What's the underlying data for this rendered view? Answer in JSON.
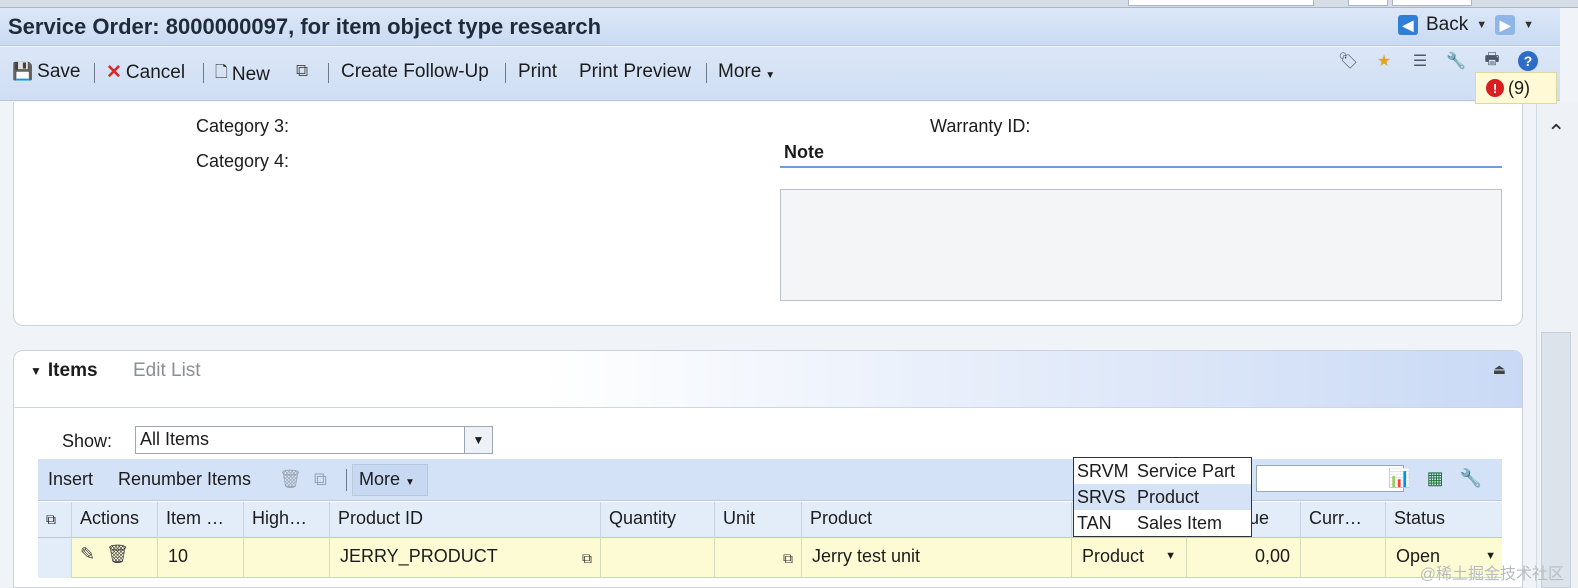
{
  "window": {
    "title": "Service Order: 8000000097, for item object type research",
    "back_label": "Back"
  },
  "toolbar": {
    "save": "Save",
    "cancel": "Cancel",
    "new": "New",
    "create_follow_up": "Create Follow-Up",
    "print": "Print",
    "print_preview": "Print Preview",
    "more": "More"
  },
  "messages": {
    "count": "(9)"
  },
  "details": {
    "category3": "Category 3:",
    "category4": "Category 4:",
    "warranty_id": "Warranty ID:",
    "note_title": "Note"
  },
  "items": {
    "title": "Items",
    "edit_list": "Edit List",
    "show_label": "Show:",
    "show_value": "All Items",
    "list_toolbar": {
      "insert": "Insert",
      "renumber": "Renumber Items",
      "more": "More"
    },
    "columns": [
      "Actions",
      "Item …",
      "High…",
      "Product ID",
      "Quantity",
      "Unit",
      "Product",
      "lue",
      "Curr…",
      "Status"
    ],
    "rows": [
      {
        "item": "10",
        "high": "",
        "product_id": "JERRY_PRODUCT",
        "quantity": "",
        "unit": "",
        "product": "Jerry test unit",
        "item_category": "Product",
        "net_value": "0,00",
        "currency": "",
        "status": "Open"
      }
    ],
    "category_dropdown": [
      {
        "code": "SRVM",
        "label": "Service Part"
      },
      {
        "code": "SRVS",
        "label": "Product"
      },
      {
        "code": "TAN",
        "label": "Sales Item"
      }
    ]
  },
  "watermark": "@稀土掘金技术社区",
  "colors": {
    "accent": "#2f7fd7",
    "error": "#d81e1e",
    "row_highlight": "#fdfbd4"
  }
}
